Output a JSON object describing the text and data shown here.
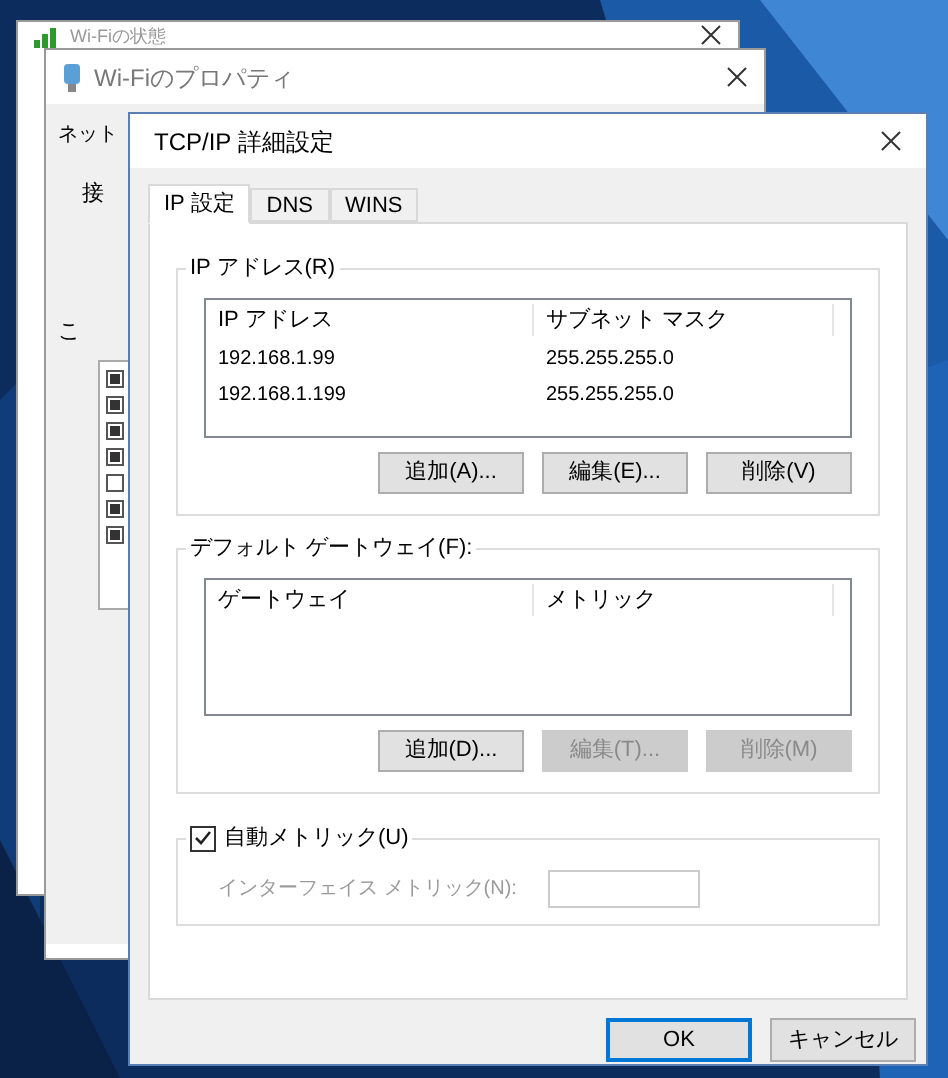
{
  "back_window": {
    "title": "Wi-Fiの状態"
  },
  "middle_window": {
    "title": "Wi-Fiのプロパティ",
    "tab": "ネット",
    "label_1": "接",
    "label_2": "こ",
    "items": [
      {
        "checked": true
      },
      {
        "checked": true
      },
      {
        "checked": true
      },
      {
        "checked": true
      },
      {
        "checked": false
      },
      {
        "checked": true
      },
      {
        "checked": true
      }
    ]
  },
  "dialog": {
    "title": "TCP/IP 詳細設定",
    "tabs": [
      {
        "label": "IP 設定",
        "selected": true
      },
      {
        "label": "DNS",
        "selected": false
      },
      {
        "label": "WINS",
        "selected": false
      }
    ],
    "ip_group": {
      "title": "IP アドレス(R)",
      "columns": [
        "IP アドレス",
        "サブネット マスク"
      ],
      "rows": [
        [
          "192.168.1.99",
          "255.255.255.0"
        ],
        [
          "192.168.1.199",
          "255.255.255.0"
        ]
      ],
      "buttons": [
        {
          "label": "追加(A)...",
          "disabled": false
        },
        {
          "label": "編集(E)...",
          "disabled": false
        },
        {
          "label": "削除(V)",
          "disabled": false
        }
      ]
    },
    "gateway_group": {
      "title": "デフォルト ゲートウェイ(F):",
      "columns": [
        "ゲートウェイ",
        "メトリック"
      ],
      "buttons": [
        {
          "label": "追加(D)...",
          "disabled": false
        },
        {
          "label": "編集(T)...",
          "disabled": true
        },
        {
          "label": "削除(M)",
          "disabled": true
        }
      ]
    },
    "auto_metric": {
      "label": "自動メトリック(U)",
      "checked": true
    },
    "interface_metric": {
      "label": "インターフェイス メトリック(N):",
      "disabled": true
    },
    "footer_buttons": [
      {
        "label": "OK",
        "default": true
      },
      {
        "label": "キャンセル",
        "default": false
      }
    ]
  }
}
